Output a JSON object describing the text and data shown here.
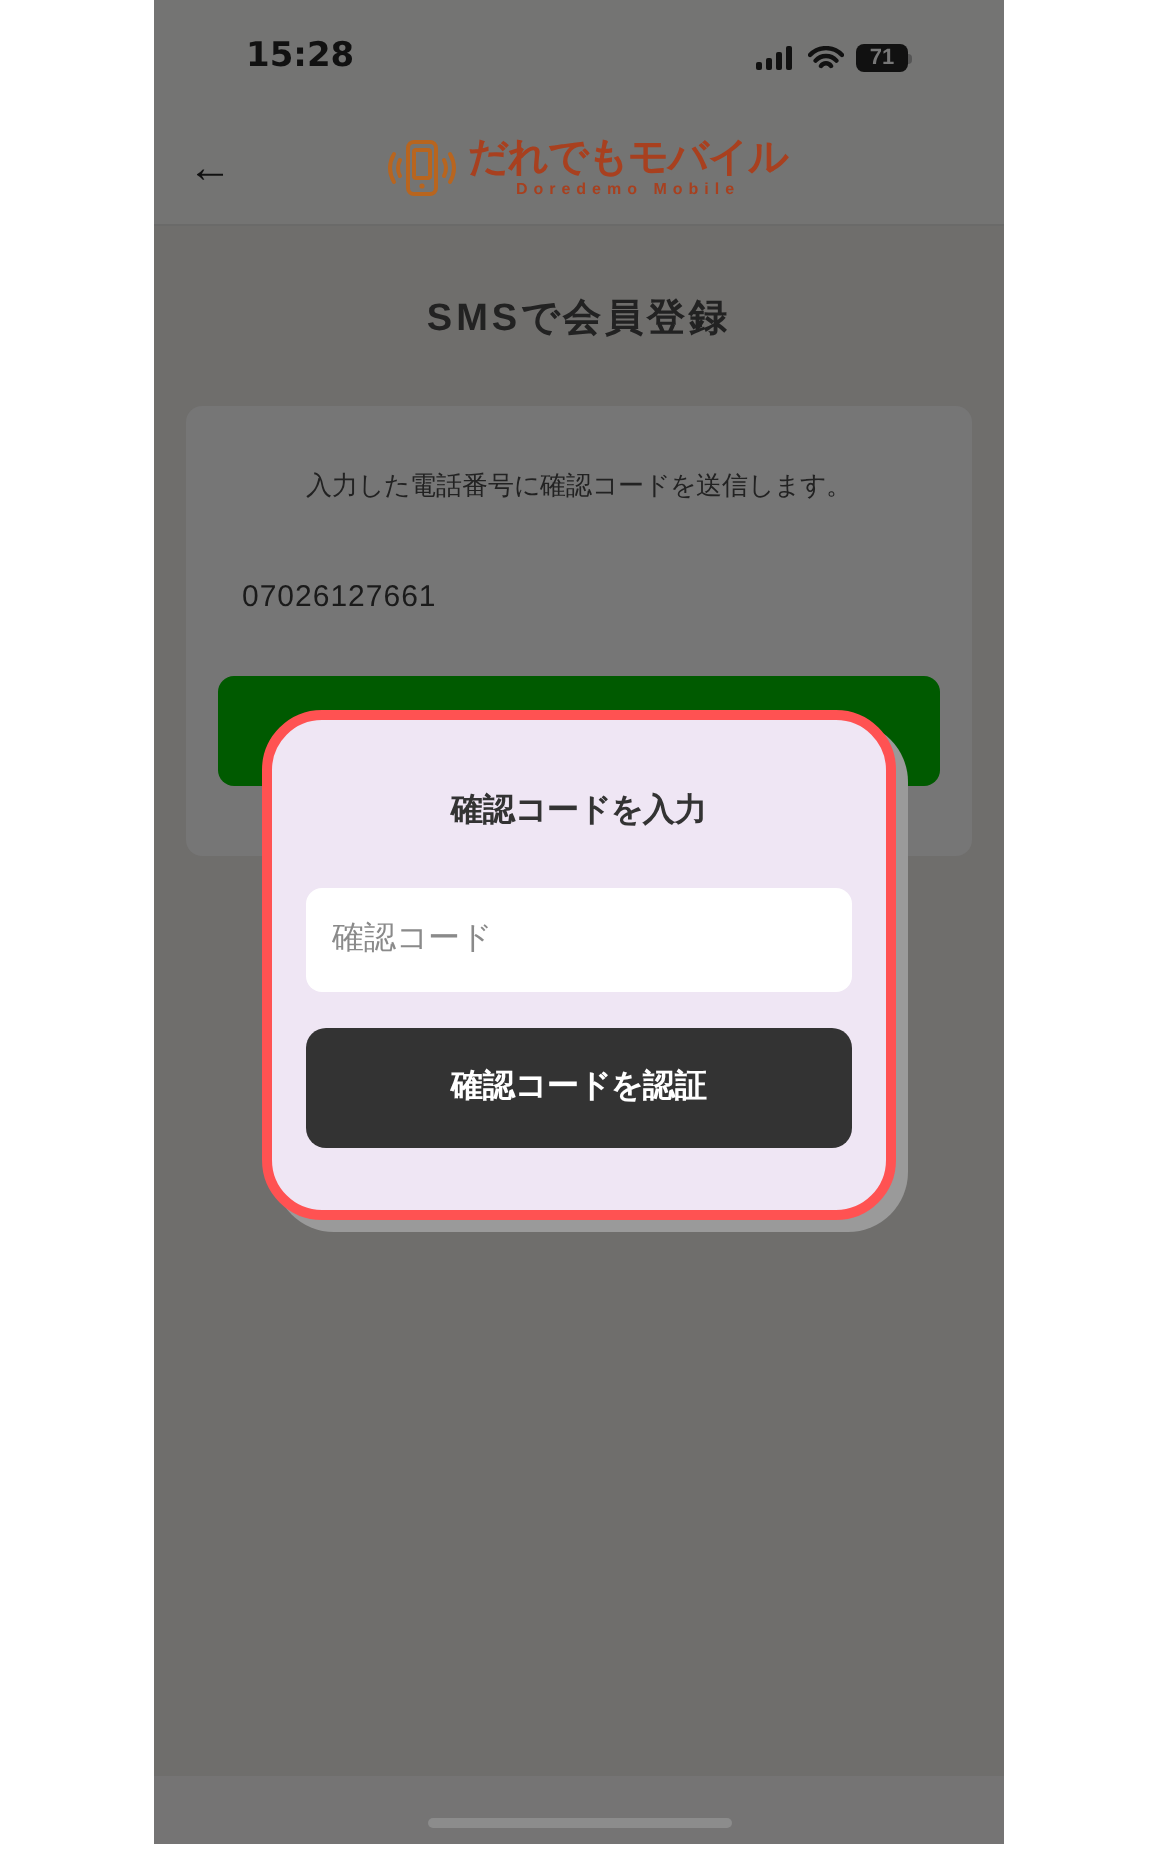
{
  "status_bar": {
    "time": "15:28",
    "battery": "71"
  },
  "header": {
    "back": "←",
    "logo_text": "だれでもモバイル",
    "logo_subtext": "Doredemo Mobile"
  },
  "page": {
    "title": "SMSで会員登録",
    "description": "入力した電話番号に確認コードを送信します。",
    "phone_number": "07026127661"
  },
  "dialog": {
    "title": "確認コードを入力",
    "placeholder": "確認コード",
    "button": "確認コードを認証"
  }
}
